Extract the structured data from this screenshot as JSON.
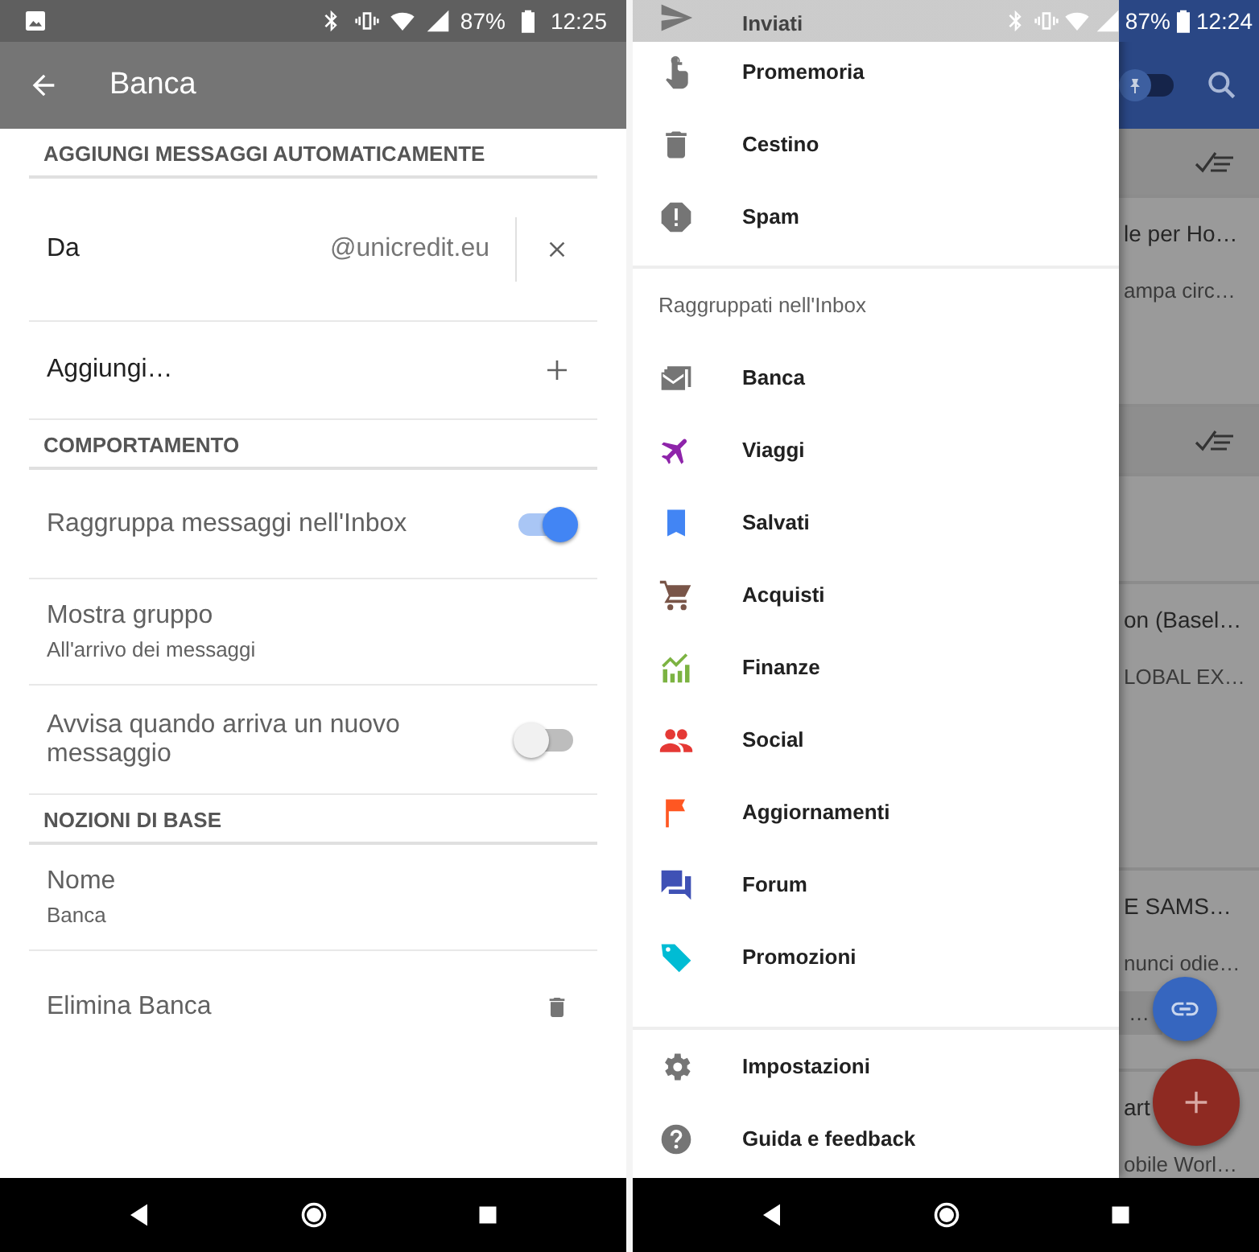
{
  "left_screen": {
    "status_bar": {
      "battery": "87%",
      "time": "12:25"
    },
    "toolbar": {
      "title": "Banca"
    },
    "sections": [
      {
        "header": "AGGIUNGI MESSAGGI AUTOMATICAMENTE",
        "rows": [
          {
            "kind": "field",
            "label": "Da",
            "value": "@unicredit.eu"
          },
          {
            "kind": "add",
            "label": "Aggiungi…"
          }
        ]
      },
      {
        "header": "COMPORTAMENTO",
        "rows": [
          {
            "kind": "switch",
            "label": "Raggruppa messaggi nell'Inbox",
            "on": true
          },
          {
            "kind": "detail",
            "label": "Mostra gruppo",
            "sub": "All'arrivo dei messaggi"
          },
          {
            "kind": "switch",
            "label": "Avvisa quando arriva un nuovo messaggio",
            "on": false
          }
        ]
      },
      {
        "header": "NOZIONI DI BASE",
        "rows": [
          {
            "kind": "detail",
            "label": "Nome",
            "sub": "Banca"
          },
          {
            "kind": "delete",
            "label": "Elimina Banca"
          }
        ]
      }
    ]
  },
  "right_screen": {
    "status_bar": {
      "battery": "87%",
      "time": "12:24"
    },
    "drawer": {
      "items": [
        {
          "label": "Inviati"
        },
        {
          "label": "Promemoria"
        },
        {
          "label": "Cestino"
        },
        {
          "label": "Spam"
        }
      ],
      "group_header": "Raggruppati nell'Inbox",
      "groups": [
        {
          "label": "Banca",
          "color": "#757575"
        },
        {
          "label": "Viaggi",
          "color": "#8e24aa"
        },
        {
          "label": "Salvati",
          "color": "#4285f4"
        },
        {
          "label": "Acquisti",
          "color": "#795548"
        },
        {
          "label": "Finanze",
          "color": "#7cb342"
        },
        {
          "label": "Social",
          "color": "#e53935"
        },
        {
          "label": "Aggiornamenti",
          "color": "#ff5722"
        },
        {
          "label": "Forum",
          "color": "#3f51b5"
        },
        {
          "label": "Promozioni",
          "color": "#00bcd4"
        }
      ],
      "footer": [
        {
          "label": "Impostazioni"
        },
        {
          "label": "Guida e feedback"
        }
      ]
    },
    "inbox_behind": {
      "rows": [
        {
          "kind": "header"
        },
        {
          "kind": "message",
          "title": "le per Ho…",
          "snippet": "ampa circ…"
        },
        {
          "kind": "header"
        },
        {
          "kind": "message"
        },
        {
          "kind": "message",
          "title": "on (Basel…",
          "snippet": "LOBAL EX…"
        },
        {
          "kind": "message",
          "title": "E SAMS…",
          "snippet": "nunci odie…",
          "chip": "…"
        },
        {
          "kind": "message",
          "title": "art",
          "snippet": "obile Worl…"
        }
      ]
    }
  }
}
